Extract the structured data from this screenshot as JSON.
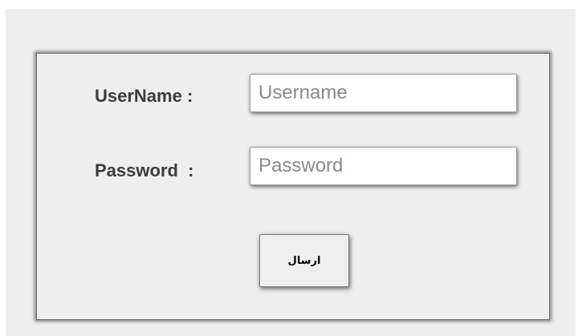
{
  "login_form": {
    "username_label": "UserName :",
    "username_placeholder": "Username",
    "username_value": "",
    "password_label": "Password  :",
    "password_placeholder": "Password",
    "password_value": "",
    "submit_label": "ارسال"
  },
  "colors": {
    "page_background": "#eeeeee",
    "panel_border": "#6f6f6f",
    "label_text": "#3c3c3c",
    "placeholder_text": "#8a8a8a"
  }
}
